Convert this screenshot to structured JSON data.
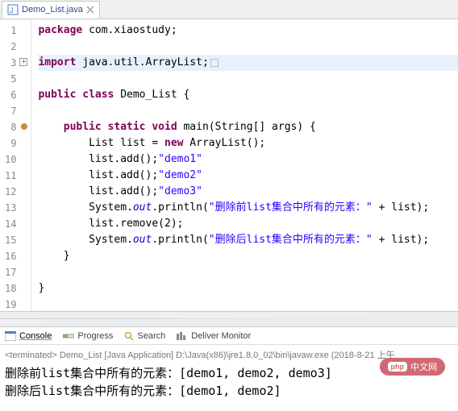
{
  "tab": {
    "title": "Demo_List.java"
  },
  "code": {
    "lines": [
      {
        "n": "1",
        "pre": "",
        "kw": "package",
        "rest": " com.xiaostudy;"
      },
      {
        "n": "2",
        "pre": "",
        "kw": "",
        "rest": ""
      },
      {
        "n": "3",
        "pre": "",
        "kw": "import",
        "rest": " java.util.ArrayList;",
        "folded": true,
        "hl": true,
        "collapsedBox": true
      },
      {
        "n": "5",
        "pre": "",
        "kw": "",
        "rest": ""
      },
      {
        "n": "6",
        "pre": "",
        "kw": "public class",
        "rest": " Demo_List {"
      },
      {
        "n": "7",
        "pre": "",
        "kw": "",
        "rest": ""
      },
      {
        "n": "8",
        "pre": "    ",
        "kw": "public static void",
        "rest": " main(String[] args) {",
        "error": true
      },
      {
        "n": "9",
        "pre": "        ",
        "kw": "",
        "rest_a": "List list = ",
        "kw2": "new",
        "rest_b": " ArrayList();"
      },
      {
        "n": "10",
        "pre": "        ",
        "kw": "",
        "rest_a": "list.add(",
        "str": "\"demo1\"",
        "rest_b": ");"
      },
      {
        "n": "11",
        "pre": "        ",
        "kw": "",
        "rest_a": "list.add(",
        "str": "\"demo2\"",
        "rest_b": ");"
      },
      {
        "n": "12",
        "pre": "        ",
        "kw": "",
        "rest_a": "list.add(",
        "str": "\"demo3\"",
        "rest_b": ");"
      },
      {
        "n": "13",
        "pre": "        ",
        "kw": "",
        "rest_a": "System.",
        "field": "out",
        "rest_b": ".println(",
        "str": "\"删除前list集合中所有的元素：\"",
        "rest_c": " + list);"
      },
      {
        "n": "14",
        "pre": "        ",
        "kw": "",
        "rest_a": "list.remove(2);",
        "str": "",
        "rest_b": ""
      },
      {
        "n": "15",
        "pre": "        ",
        "kw": "",
        "rest_a": "System.",
        "field": "out",
        "rest_b": ".println(",
        "str": "\"删除后list集合中所有的元素：\"",
        "rest_c": " + list);"
      },
      {
        "n": "16",
        "pre": "    ",
        "kw": "",
        "rest": "}"
      },
      {
        "n": "17",
        "pre": "",
        "kw": "",
        "rest": ""
      },
      {
        "n": "18",
        "pre": "",
        "kw": "",
        "rest": "}"
      },
      {
        "n": "19",
        "pre": "",
        "kw": "",
        "rest": ""
      }
    ]
  },
  "consoleTabs": {
    "console": "Console",
    "progress": "Progress",
    "search": "Search",
    "monitor": "Deliver Monitor"
  },
  "console": {
    "terminated": "<terminated> Demo_List [Java Application] D:\\Java(x86)\\jre1.8.0_02\\bin\\javaw.exe (2018-8-21 上午",
    "out1": "删除前list集合中所有的元素：[demo1, demo2, demo3]",
    "out2": "删除后list集合中所有的元素：[demo1, demo2]"
  },
  "watermark": "中文网"
}
